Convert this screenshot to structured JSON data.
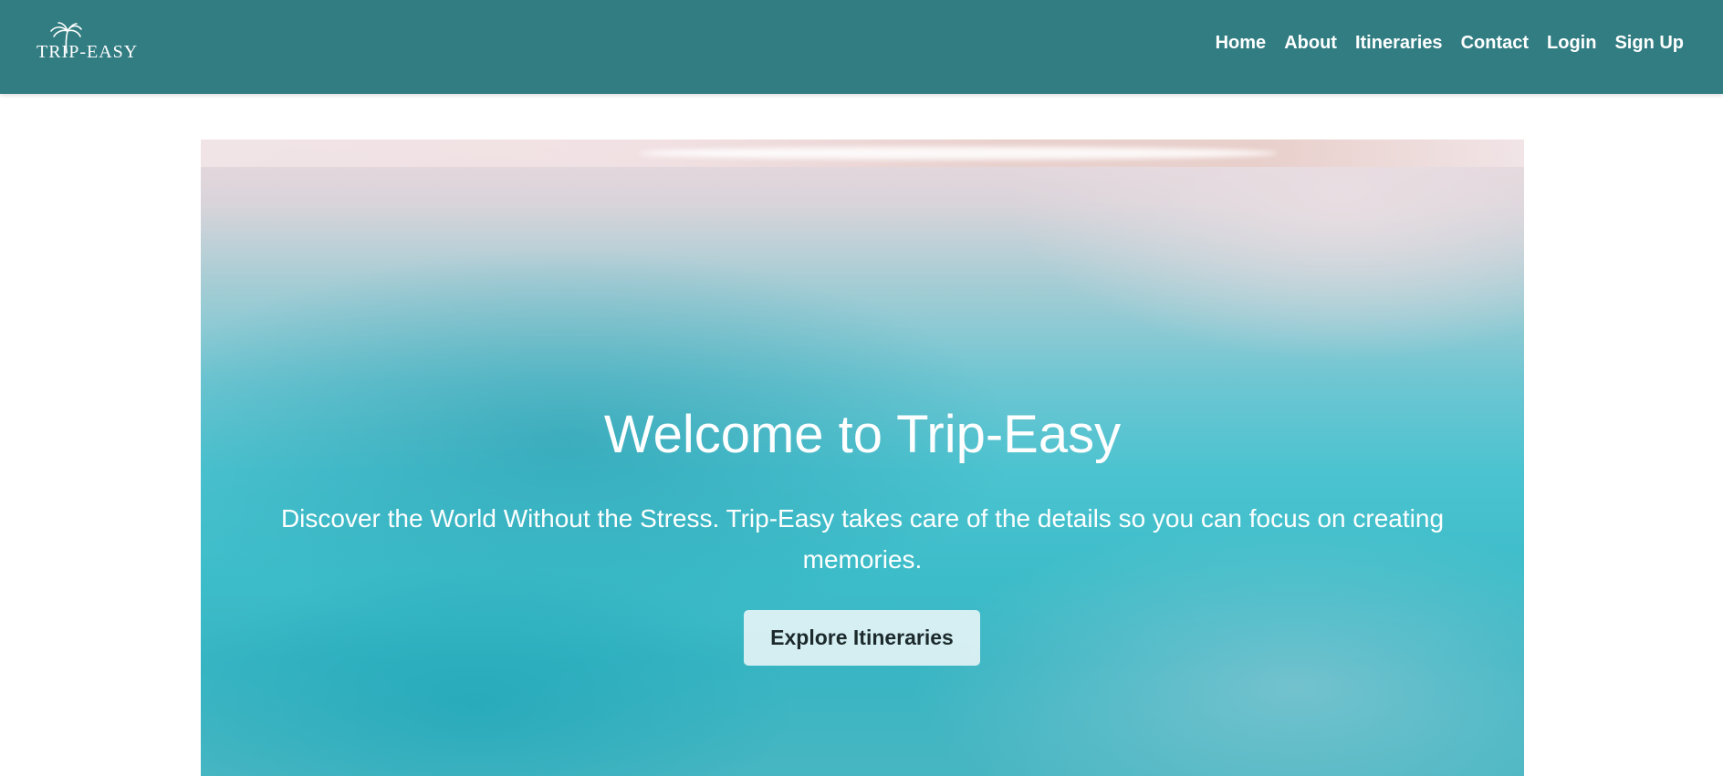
{
  "header": {
    "logo_text": "TRIP-EASY",
    "logo_icon": "palm-tree-icon",
    "nav": [
      {
        "label": "Home"
      },
      {
        "label": "About"
      },
      {
        "label": "Itineraries"
      },
      {
        "label": "Contact"
      },
      {
        "label": "Login"
      },
      {
        "label": "Sign Up"
      }
    ]
  },
  "hero": {
    "title": "Welcome to Trip-Easy",
    "subtitle": "Discover the World Without the Stress. Trip-Easy takes care of the details so you can focus on creating memories.",
    "button_label": "Explore Itineraries"
  },
  "colors": {
    "navbar": "#327d82",
    "text_on_dark": "#ffffff",
    "button_bg": "#ebf6f8",
    "button_text": "#1c2a2c"
  }
}
